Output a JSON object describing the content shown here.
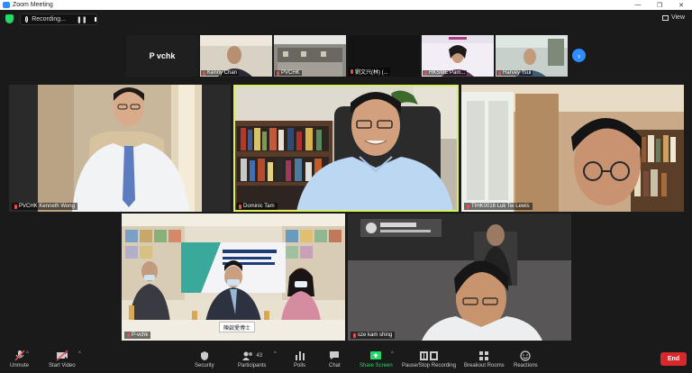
{
  "window": {
    "title": "Zoom Meeting"
  },
  "recording": {
    "label": "Recording..."
  },
  "view": {
    "label": "View"
  },
  "thumbnails": [
    {
      "name": "P vchk"
    },
    {
      "name": "Kenny Chan"
    },
    {
      "name": "PVCHK"
    },
    {
      "name": "劉文兴(林) (..."
    },
    {
      "name": "HKSME Pam..."
    },
    {
      "name": "Harvey Tsui"
    }
  ],
  "tiles": [
    {
      "name": "PVCHK Kenneth Wong"
    },
    {
      "name": "Dominic Tam"
    },
    {
      "name": "TIHK0016 Luk Tei Lewis"
    },
    {
      "name": "P-vchk"
    },
    {
      "name": "sze kam shing"
    }
  ],
  "placard": {
    "text": "陳啟愛博士"
  },
  "toolbar": {
    "unmute": "Unmute",
    "start_video": "Start Video",
    "security": "Security",
    "participants": "Participants",
    "participants_count": "43",
    "polls": "Polls",
    "chat": "Chat",
    "share_screen": "Share Screen",
    "pause_stop_recording": "Pause/Stop Recording",
    "breakout_rooms": "Breakout Rooms",
    "reactions": "Reactions",
    "end": "End"
  },
  "colors": {
    "active_speaker": "#d8f060",
    "share": "#23d96a",
    "end": "#d8282c",
    "accent": "#2d8cff"
  }
}
